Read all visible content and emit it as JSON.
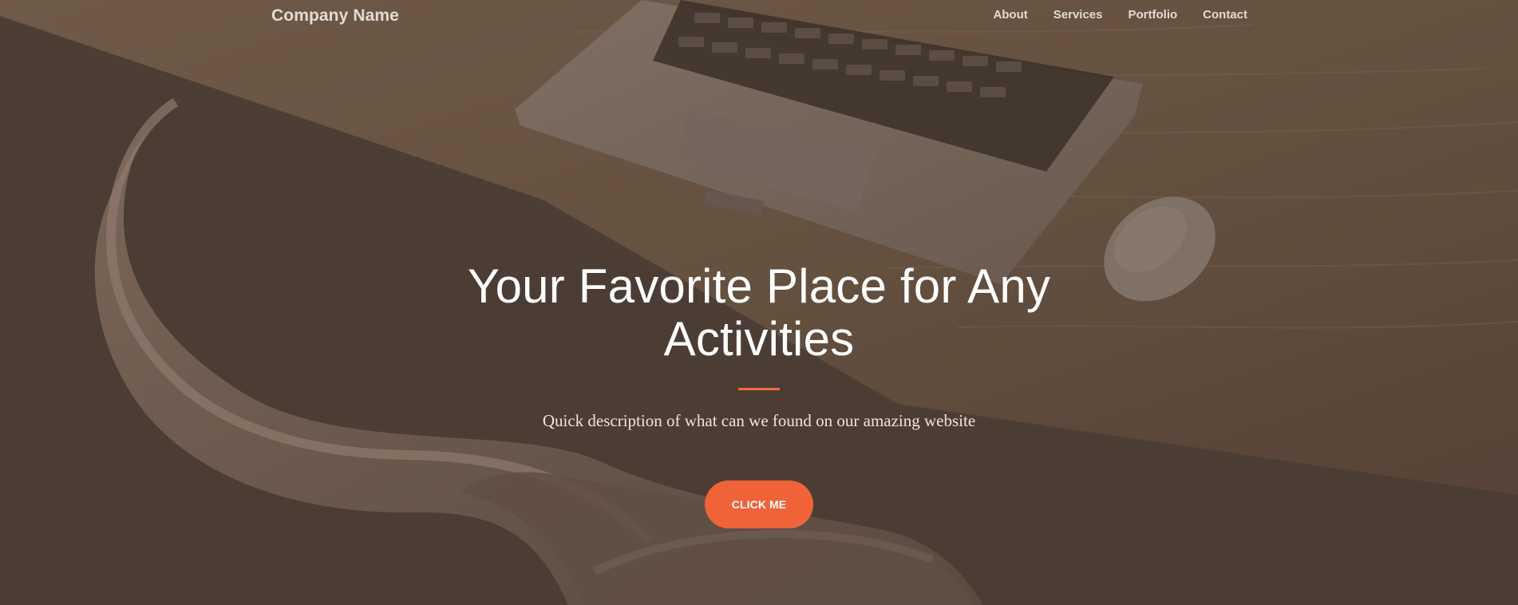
{
  "brand": {
    "name": "Company Name"
  },
  "navigation": {
    "items": [
      {
        "label": "About"
      },
      {
        "label": "Services"
      },
      {
        "label": "Portfolio"
      },
      {
        "label": "Contact"
      }
    ]
  },
  "hero": {
    "headline": "Your Favorite Place for Any Activities",
    "subtitle": "Quick description of what can we found on our amazing website",
    "button_label": "CLICK ME",
    "background_scene": "laptop-desk-chair-photo"
  },
  "colors": {
    "overlay": "#4f4037",
    "accent": "#f06339",
    "text": "#ffffff"
  }
}
